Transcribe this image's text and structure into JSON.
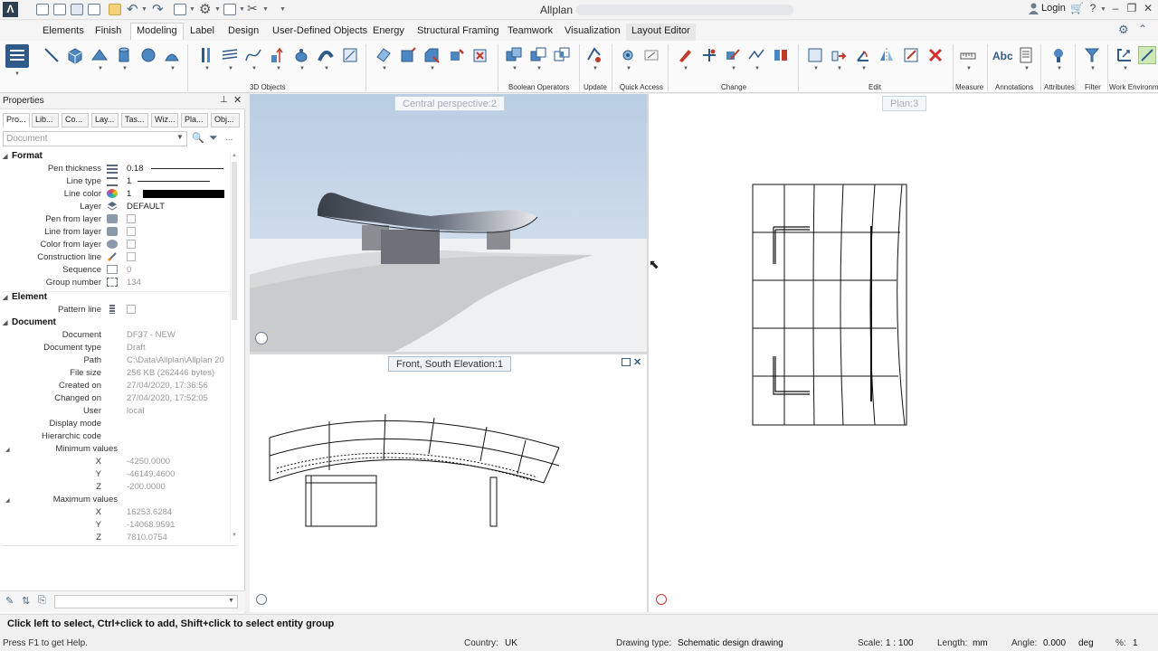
{
  "app": {
    "title": "Allplan -",
    "login_label": "Login",
    "accent": "#2f5b8a"
  },
  "ribbon": {
    "tabs": [
      {
        "label": "Elements"
      },
      {
        "label": "Finish"
      },
      {
        "label": "Modeling",
        "active": true
      },
      {
        "label": "Label"
      },
      {
        "label": "Design"
      },
      {
        "label": "User-Defined Objects"
      },
      {
        "label": "Energy"
      },
      {
        "label": "Structural Framing"
      },
      {
        "label": "Teamwork"
      },
      {
        "label": "Visualization"
      },
      {
        "label": "Layout Editor"
      }
    ],
    "groups": [
      {
        "label": "3D Objects"
      },
      {
        "label": "Boolean Operators"
      },
      {
        "label": "Update"
      },
      {
        "label": "Quick Access"
      },
      {
        "label": "Change"
      },
      {
        "label": "Edit"
      },
      {
        "label": "Measure"
      },
      {
        "label": "Annotations"
      },
      {
        "label": "Attributes"
      },
      {
        "label": "Filter"
      },
      {
        "label": "Work Environme"
      }
    ],
    "annotations_text": "Abc"
  },
  "properties": {
    "title": "Properties",
    "tabs": [
      "Pro...",
      "Lib...",
      "Co...",
      "Lay...",
      "Tas...",
      "Wiz...",
      "Pla...",
      "Obj..."
    ],
    "selector_placeholder": "Document",
    "sections": {
      "format": "Format",
      "element": "Element",
      "document": "Document",
      "minimum": "Minimum values",
      "maximum": "Maximum values"
    },
    "format": {
      "pen_thickness": {
        "label": "Pen thickness",
        "value": "0.18"
      },
      "line_type": {
        "label": "Line type",
        "value": "1"
      },
      "line_color": {
        "label": "Line color",
        "value": "1"
      },
      "layer": {
        "label": "Layer",
        "value": "DEFAULT"
      },
      "pen_from_layer": {
        "label": "Pen from layer"
      },
      "line_from_layer": {
        "label": "Line from layer"
      },
      "color_from_layer": {
        "label": "Color from layer"
      },
      "construction_line": {
        "label": "Construction line"
      },
      "sequence": {
        "label": "Sequence",
        "value": "0"
      },
      "group_number": {
        "label": "Group number",
        "value": "134"
      }
    },
    "element": {
      "pattern_line": {
        "label": "Pattern line"
      }
    },
    "document": {
      "document": {
        "label": "Document",
        "value": "DF37 - NEW"
      },
      "document_type": {
        "label": "Document type",
        "value": "Draft"
      },
      "path": {
        "label": "Path",
        "value": "C:\\Data\\Allplan\\Allplan 20"
      },
      "file_size": {
        "label": "File size",
        "value": "256 KB (262446 bytes)"
      },
      "created_on": {
        "label": "Created on",
        "value": "27/04/2020, 17:36:56"
      },
      "changed_on": {
        "label": "Changed on",
        "value": "27/04/2020, 17:52:05"
      },
      "user": {
        "label": "User",
        "value": "local"
      },
      "display_mode": {
        "label": "Display mode"
      },
      "hierarchic_code": {
        "label": "Hierarchic code"
      }
    },
    "minimum": {
      "x_label": "X",
      "x": "-4250.0000",
      "y_label": "Y",
      "y": "-46149.4600",
      "z_label": "Z",
      "z": "-200.0000"
    },
    "maximum": {
      "x_label": "X",
      "x": "16253.6284",
      "y_label": "Y",
      "y": "-14068.9591",
      "z_label": "Z",
      "z": "7810.0754"
    }
  },
  "viewports": {
    "perspective": "Central perspective:2",
    "plan": "Plan:3",
    "elevation": "Front, South Elevation:1"
  },
  "command_line": "Click left to select, Ctrl+click to add, Shift+click to select entity group",
  "status": {
    "help": "Press F1 to get Help.",
    "country_label": "Country:",
    "country": "UK",
    "drawing_type_label": "Drawing type:",
    "drawing_type": "Schematic design drawing",
    "scale_label": "Scale:",
    "scale": "1 : 100",
    "length_label": "Length:",
    "length": "mm",
    "angle_label": "Angle:",
    "angle": "0.000",
    "angle_unit": "deg",
    "percent_label": "%:",
    "percent": "1"
  }
}
